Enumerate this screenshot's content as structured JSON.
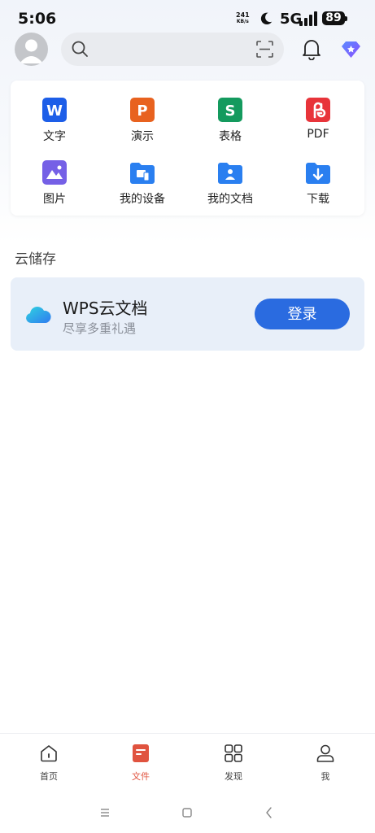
{
  "status_bar": {
    "time": "5:06",
    "net_speed_value": "241",
    "net_speed_unit": "KB/s",
    "network_type": "5G",
    "battery_level": "89"
  },
  "header": {
    "search_placeholder": "",
    "icons": [
      "avatar",
      "search-icon",
      "scan-icon",
      "bell-icon",
      "vip-diamond-icon"
    ]
  },
  "quick_access": {
    "items": [
      {
        "label": "文字",
        "icon": "word-doc-icon",
        "color": "#1d5ee8"
      },
      {
        "label": "演示",
        "icon": "presentation-icon",
        "color": "#e8621f"
      },
      {
        "label": "表格",
        "icon": "spreadsheet-icon",
        "color": "#149a5e"
      },
      {
        "label": "PDF",
        "icon": "pdf-icon",
        "color": "#e8343a"
      },
      {
        "label": "图片",
        "icon": "image-icon",
        "color": "#7560e6"
      },
      {
        "label": "我的设备",
        "icon": "device-folder-icon",
        "color": "#2a7ff0"
      },
      {
        "label": "我的文档",
        "icon": "document-folder-icon",
        "color": "#2a7ff0"
      },
      {
        "label": "下载",
        "icon": "download-folder-icon",
        "color": "#2a7ff0"
      }
    ]
  },
  "cloud_storage": {
    "section_title": "云储存",
    "title": "WPS云文档",
    "subtitle": "尽享多重礼遇",
    "login_label": "登录"
  },
  "bottom_nav": {
    "items": [
      {
        "label": "首页",
        "icon": "home-icon",
        "active": false
      },
      {
        "label": "文件",
        "icon": "file-icon",
        "active": true
      },
      {
        "label": "发现",
        "icon": "discover-grid-icon",
        "active": false
      },
      {
        "label": "我",
        "icon": "profile-icon",
        "active": false
      }
    ]
  },
  "colors": {
    "accent": "#2a6be0",
    "active_tab": "#e0533f"
  }
}
